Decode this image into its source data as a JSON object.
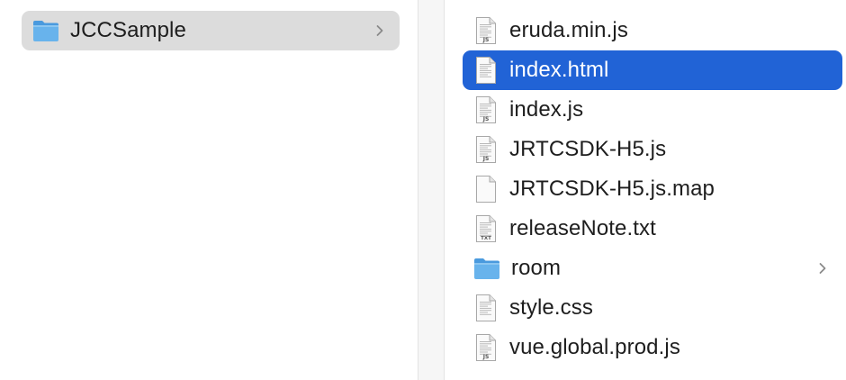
{
  "left_column": {
    "folder": {
      "name": "JCCSample",
      "icon": "folder-icon",
      "has_children": true
    }
  },
  "right_column": {
    "items": [
      {
        "name": "eruda.min.js",
        "icon": "js-file-icon",
        "badge": "JS",
        "selected": false
      },
      {
        "name": "index.html",
        "icon": "html-file-icon",
        "badge": "",
        "selected": true
      },
      {
        "name": "index.js",
        "icon": "js-file-icon",
        "badge": "JS",
        "selected": false
      },
      {
        "name": "JRTCSDK-H5.js",
        "icon": "js-file-icon",
        "badge": "JS",
        "selected": false
      },
      {
        "name": "JRTCSDK-H5.js.map",
        "icon": "blank-file-icon",
        "badge": "",
        "selected": false
      },
      {
        "name": "releaseNote.txt",
        "icon": "txt-file-icon",
        "badge": "TXT",
        "selected": false
      },
      {
        "name": "room",
        "icon": "folder-icon",
        "badge": "",
        "selected": false,
        "has_children": true
      },
      {
        "name": "style.css",
        "icon": "css-file-icon",
        "badge": "",
        "selected": false
      },
      {
        "name": "vue.global.prod.js",
        "icon": "js-file-icon",
        "badge": "JS",
        "selected": false
      }
    ]
  },
  "colors": {
    "selection": "#2163d6",
    "parent_selection": "#dcdcdc",
    "folder_blue": "#5aa9e6"
  }
}
